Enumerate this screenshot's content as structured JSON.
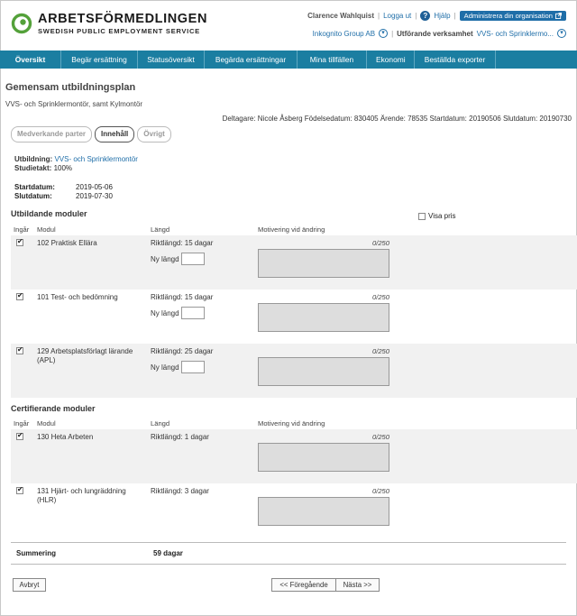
{
  "header": {
    "brand_name": "ARBETSFÖRMEDLINGEN",
    "brand_sub": "SWEDISH PUBLIC EMPLOYMENT SERVICE",
    "user_name": "Clarence Wahlquist",
    "logout": "Logga ut",
    "help_icon_glyph": "?",
    "help": "Hjälp",
    "admin_button": "Administrera din organisation",
    "org_name": "Inkognito Group AB",
    "verksamhet_label": "Utförande verksamhet",
    "verksamhet_value": "VVS- och Sprinklermo...",
    "colors": {
      "nav_bg": "#1b7ea1",
      "link": "#1f6ea8",
      "logo_green": "#54a13a"
    }
  },
  "nav": {
    "items": [
      "Översikt",
      "Begär ersättning",
      "Statusöversikt",
      "Begärda ersättningar",
      "Mina tillfällen",
      "Ekonomi",
      "Beställda exporter"
    ],
    "active": "Översikt"
  },
  "page": {
    "title": "Gemensam utbildningsplan",
    "subtitle": "VVS- och Sprinklermontör, samt Kylmontör",
    "infoline": "Deltagare: Nicole Åsberg Födelsedatum: 830405 Ärende: 78535 Startdatum: 20190506 Slutdatum: 20190730"
  },
  "tabs": {
    "medverkande": "Medverkande parter",
    "innehall": "Innehåll",
    "ovrigt": "Övrigt",
    "active": "Innehåll"
  },
  "details": {
    "utbildning_label": "Utbildning:",
    "utbildning_value": "VVS- och Sprinklermontör",
    "studietakt_label": "Studietakt:",
    "studietakt_value": "100%",
    "startdatum_label": "Startdatum:",
    "startdatum_value": "2019-05-06",
    "slutdatum_label": "Slutdatum:",
    "slutdatum_value": "2019-07-30"
  },
  "table_headers": {
    "ingar": "Ingår",
    "modul": "Modul",
    "langd": "Längd",
    "motivering": "Motivering vid ändring"
  },
  "utbildande": {
    "title": "Utbildande moduler",
    "visa_pris": "Visa pris",
    "rows": [
      {
        "name": "102 Praktisk Ellära",
        "rikt": "Riktlängd: 15 dagar",
        "ny_langd": "Ny längd",
        "count": "0/250",
        "checked": true
      },
      {
        "name": "101 Test- och bedömning",
        "rikt": "Riktlängd: 15 dagar",
        "ny_langd": "Ny längd",
        "count": "0/250",
        "checked": true
      },
      {
        "name": "129 Arbetsplatsförlagt lärande (APL)",
        "rikt": "Riktlängd: 25 dagar",
        "ny_langd": "Ny längd",
        "count": "0/250",
        "checked": true
      }
    ]
  },
  "certifierande": {
    "title": "Certifierande moduler",
    "rows": [
      {
        "name": "130 Heta Arbeten",
        "rikt": "Riktlängd: 1 dagar",
        "count": "0/250",
        "checked": true
      },
      {
        "name": "131 Hjärt- och lungräddning (HLR)",
        "rikt": "Riktlängd: 3 dagar",
        "count": "0/250",
        "checked": true
      }
    ]
  },
  "summary": {
    "label": "Summering",
    "value": "59 dagar"
  },
  "footer": {
    "cancel": "Avbryt",
    "previous": "<< Föregående",
    "next": "Nästa >>"
  }
}
